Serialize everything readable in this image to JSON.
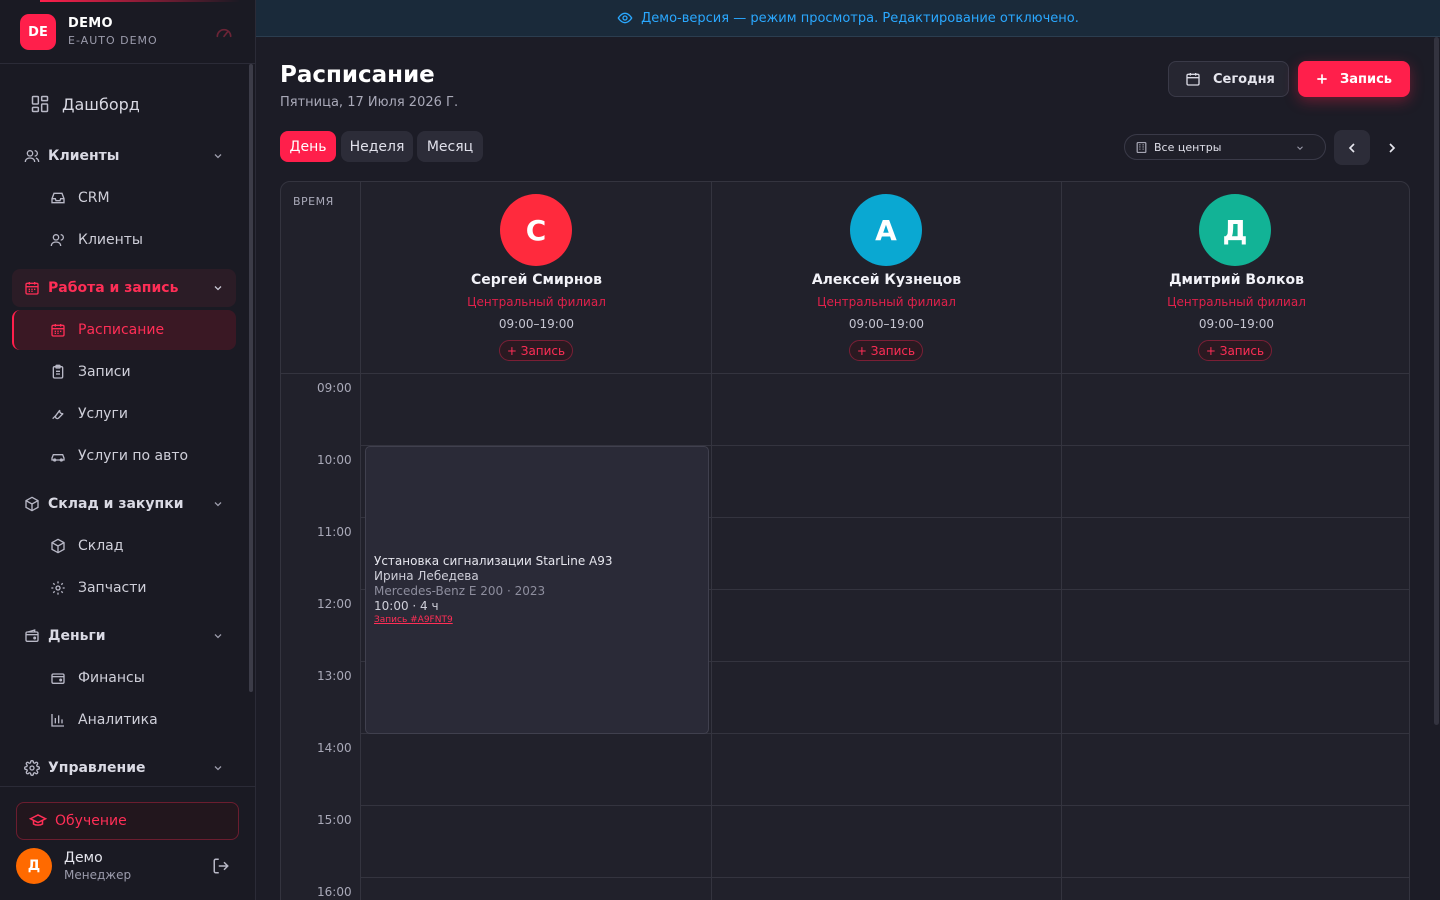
{
  "brand": {
    "logo": "DE",
    "name": "DEMO",
    "subtitle": "E-AUTO DEMO",
    "icon": "gauge-icon"
  },
  "banner": {
    "text": "Демо-версия — режим просмотра. Редактирование отключено.",
    "icon": "eye-icon",
    "color": "#2aa8ff"
  },
  "sidebar": {
    "dashboard": "Дашборд",
    "sections": [
      {
        "label": "Клиенты",
        "icon": "users-icon"
      },
      {
        "label": "Работа и запись",
        "icon": "calendar-icon",
        "active": true
      },
      {
        "label": "Склад и закупки",
        "icon": "box-icon"
      },
      {
        "label": "Деньги",
        "icon": "wallet-icon"
      },
      {
        "label": "Управление",
        "icon": "gear-icon"
      }
    ],
    "items": [
      {
        "label": "CRM",
        "icon": "inbox-icon"
      },
      {
        "label": "Клиенты",
        "icon": "users-icon"
      },
      {
        "label": "Расписание",
        "icon": "calendar-icon",
        "active": true
      },
      {
        "label": "Записи",
        "icon": "clipboard-icon"
      },
      {
        "label": "Услуги",
        "icon": "wrench-icon"
      },
      {
        "label": "Услуги по авто",
        "icon": "car-icon"
      },
      {
        "label": "Склад",
        "icon": "box-icon"
      },
      {
        "label": "Запчасти",
        "icon": "cog-icon"
      },
      {
        "label": "Финансы",
        "icon": "wallet-icon"
      },
      {
        "label": "Аналитика",
        "icon": "bar-chart-icon"
      }
    ],
    "learn": "Обучение"
  },
  "user": {
    "initial": "Д",
    "name": "Демо",
    "role": "Менеджер"
  },
  "page": {
    "title": "Расписание",
    "date": "Пятница, 17 Июля 2026 Г."
  },
  "toolbar": {
    "today": "Сегодня",
    "new_booking": "Запись"
  },
  "tabs": [
    {
      "label": "День",
      "active": true
    },
    {
      "label": "Неделя"
    },
    {
      "label": "Месяц"
    }
  ],
  "filter": {
    "center": "Все центры"
  },
  "accent": "#ff1f4b",
  "schedule": {
    "time_header": "ВРЕМЯ",
    "hours": [
      "09:00",
      "10:00",
      "11:00",
      "12:00",
      "13:00",
      "14:00",
      "15:00",
      "16:00"
    ],
    "masters": [
      {
        "initial": "С",
        "name": "Сергей Смирнов",
        "branch": "Центральный филиал",
        "hours": "09:00–19:00",
        "add": "+ Запись",
        "color": "#ff2a3d"
      },
      {
        "initial": "А",
        "name": "Алексей Кузнецов",
        "branch": "Центральный филиал",
        "hours": "09:00–19:00",
        "add": "+ Запись",
        "color": "#0aa8d2"
      },
      {
        "initial": "Д",
        "name": "Дмитрий Волков",
        "branch": "Центральный филиал",
        "hours": "09:00–19:00",
        "add": "+ Запись",
        "color": "#12b396"
      }
    ],
    "events": [
      {
        "title": "Установка сигнализации StarLine A93",
        "client": "Ирина Лебедева",
        "car": "Mercedes-Benz E 200 · 2023",
        "time": "10:00 · 4 ч",
        "link": "Запись #A9FNT9"
      }
    ]
  }
}
